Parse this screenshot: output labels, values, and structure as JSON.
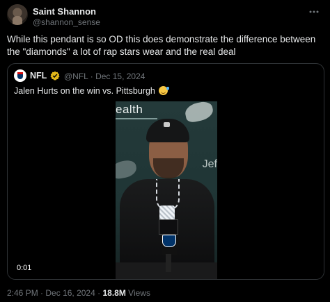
{
  "tweet": {
    "author": {
      "display_name": "Saint Shannon",
      "handle": "@shannon_sense"
    },
    "text": "While this pendant is so OD this does demonstrate the difference between the \"diamonds\" a lot of rap stars wear and the real deal",
    "posted_time": "2:46 PM",
    "posted_date": "Dec 16, 2024",
    "views_count": "18.8M",
    "views_label": "Views",
    "separator": "·"
  },
  "quote": {
    "author_name": "NFL",
    "handle_date": "@NFL · Dec 15, 2024",
    "text": "Jalen Hurts on the win vs. Pittsburgh",
    "video": {
      "timestamp": "0:01",
      "backdrop_text": "ealth",
      "backdrop_text_2": "Jef"
    }
  },
  "icons": {
    "more": "more-horizontal-icon",
    "verified": "gold-verified-badge-icon",
    "emoji": "sweat-smile-emoji-icon"
  },
  "colors": {
    "background": "#000000",
    "text_primary": "#e7e9ea",
    "text_secondary": "#71767b",
    "border": "#2f3336",
    "verified_gold": "#e2b719"
  }
}
